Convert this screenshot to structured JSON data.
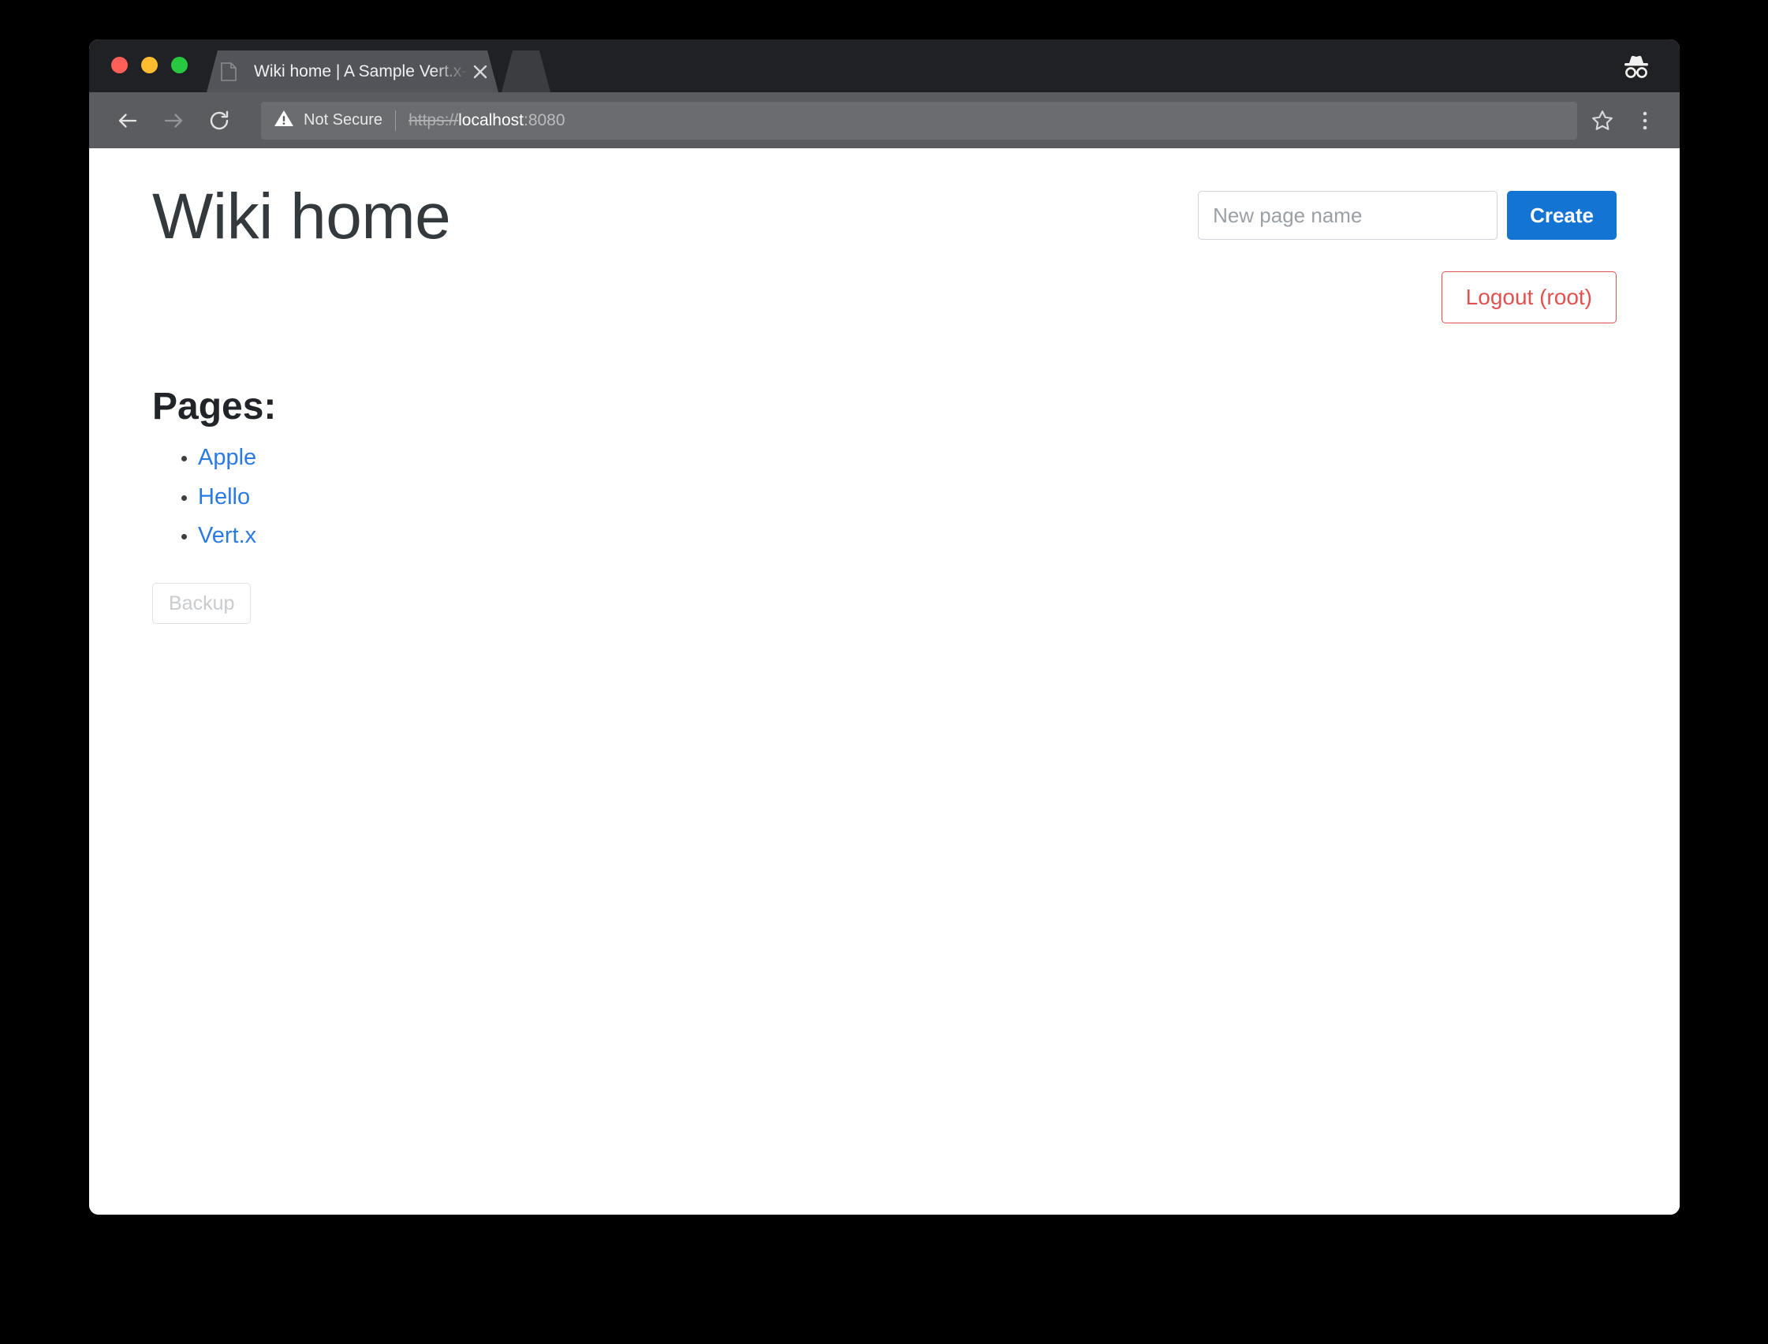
{
  "browser": {
    "window_controls": [
      {
        "name": "close",
        "color": "#ff5f56"
      },
      {
        "name": "minimize",
        "color": "#febc2e"
      },
      {
        "name": "maximize",
        "color": "#28c840"
      }
    ],
    "tab": {
      "title": "Wiki home | A Sample Vert.x-p",
      "favicon": "document-icon",
      "close_icon": "close-icon"
    },
    "new_tab_icon": "new-tab-icon",
    "incognito_icon": "incognito-icon",
    "toolbar": {
      "back_icon": "back-arrow-icon",
      "forward_icon": "forward-arrow-icon",
      "reload_icon": "reload-icon",
      "security_warning_icon": "warning-triangle-icon",
      "security_label": "Not Secure",
      "url_scheme": "https://",
      "url_host": "localhost",
      "url_port": ":8080",
      "bookmark_icon": "star-icon",
      "menu_icon": "three-dot-menu-icon"
    }
  },
  "page": {
    "title": "Wiki home",
    "create_form": {
      "input_placeholder": "New page name",
      "input_value": "",
      "create_label": "Create",
      "create_color": "#1474d4"
    },
    "logout_label": "Logout (root)",
    "logout_color": "#e0514f",
    "pages_heading": "Pages:",
    "pages": [
      {
        "label": "Apple"
      },
      {
        "label": "Hello"
      },
      {
        "label": "Vert.x"
      }
    ],
    "link_color": "#2b7ae4",
    "backup_label": "Backup"
  }
}
